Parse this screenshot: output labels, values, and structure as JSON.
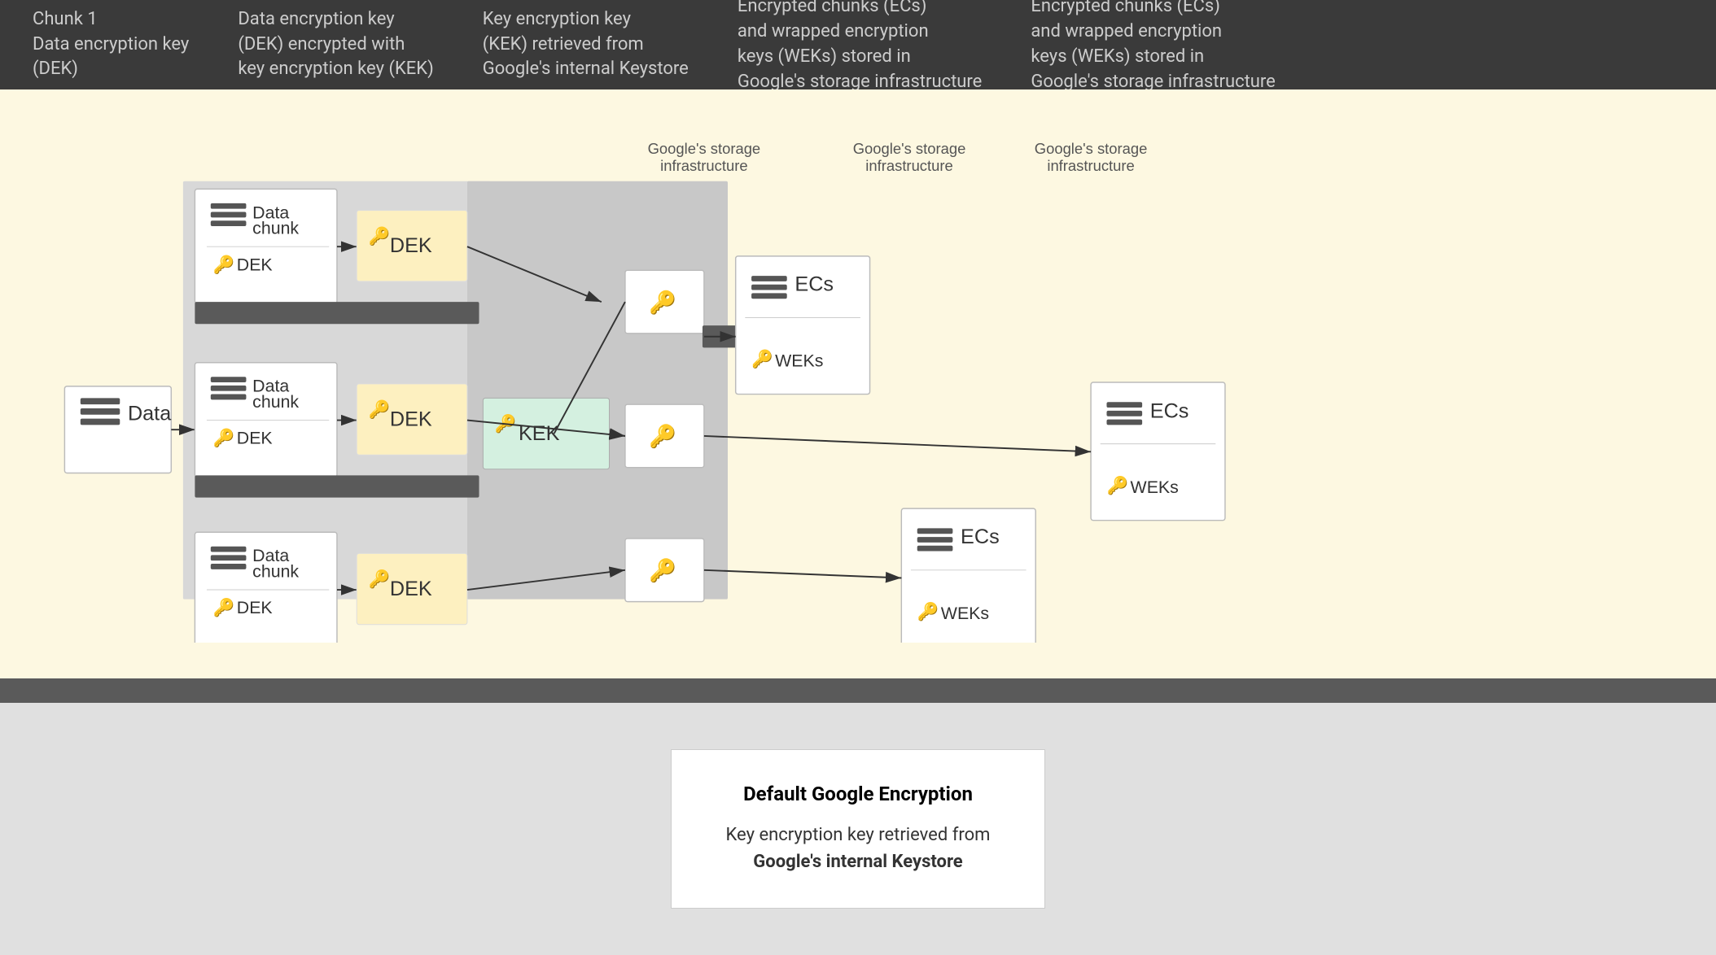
{
  "topbar": {
    "sections": [
      "Chunk 1\nData encryption key\n(DEK)",
      "Data encryption key\n(DEK) encrypted with\nkey encryption key (KEK)",
      "Key encryption key\n(KEK) retrieved from\nGoogle's internal Keystore",
      "Encrypted chunks (ECs)\nand wrapped encryption\nkeys (WEKs) stored in\nGoogle's storage infrastructure",
      "Encrypted chunks (ECs)\nand wrapped encryption\nkeys (WEKs) stored in\nGoogle's storage infrastructure"
    ]
  },
  "diagram": {
    "google_storage_labels": [
      "Google's storage\ninfrastructure",
      "Google's storage\ninfrastructure",
      "Google's storage\ninfrastructure"
    ],
    "data_label": "Data",
    "data_chunks": [
      {
        "label": "Data\nchunk",
        "dek": "DEK"
      },
      {
        "label": "Data\nchunk",
        "dek": "DEK"
      },
      {
        "label": "Data\nchunk",
        "dek": "DEK"
      }
    ],
    "dek_labels": [
      "DEK",
      "DEK",
      "DEK"
    ],
    "kek_label": "KEK",
    "ecs_labels": [
      "ECs",
      "ECs",
      "ECs"
    ],
    "weks_labels": [
      "WEKs",
      "WEKs",
      "WEKs"
    ]
  },
  "legend": {
    "title": "Default Google Encryption",
    "description": "Key encryption key retrieved from\nGoogle's internal Keystore"
  }
}
